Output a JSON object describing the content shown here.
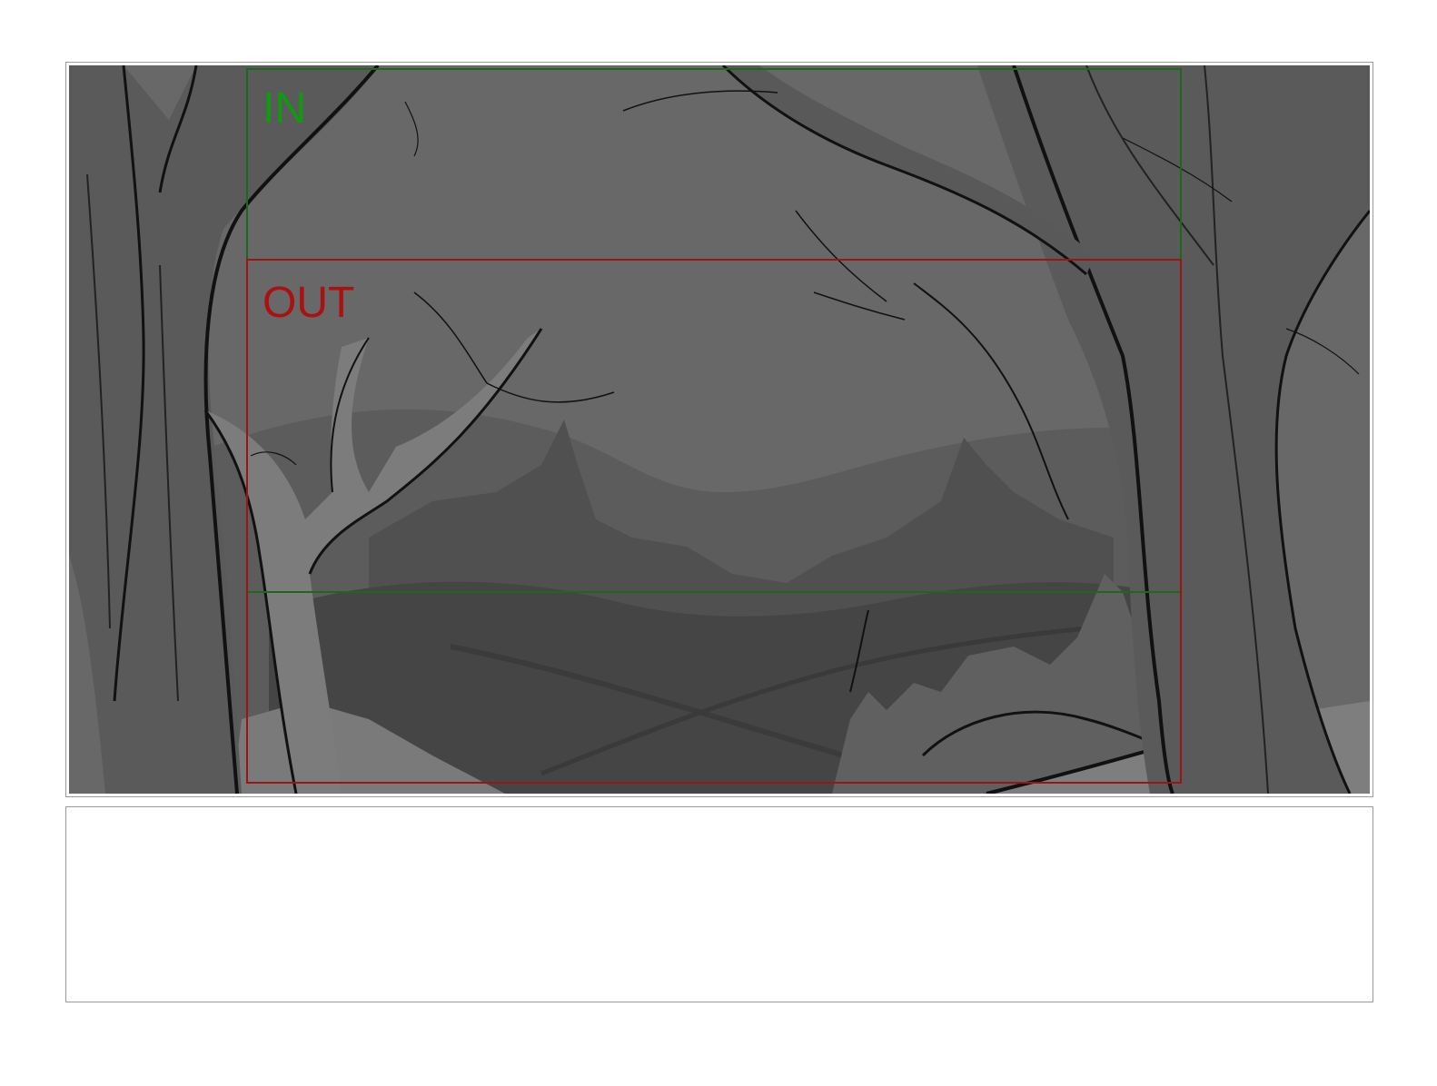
{
  "storyboard": {
    "camera_in": {
      "label": "IN",
      "color": "#119911"
    },
    "camera_out": {
      "label": "OUT",
      "color": "#aa1111"
    },
    "notes": {
      "text": ""
    },
    "colors": {
      "sky": "#6a6a6a",
      "mid_forest": "#555555",
      "dark_valley": "#474747",
      "tree_trunk": "#585858",
      "light_ground": "#7e7e7e",
      "ink": "#111111"
    }
  }
}
